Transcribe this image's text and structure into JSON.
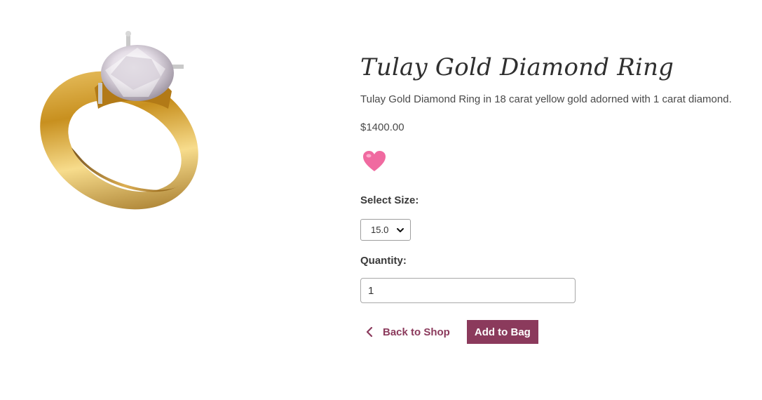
{
  "product": {
    "title": "Tulay Gold Diamond Ring",
    "description": "Tulay Gold Diamond Ring in 18 carat yellow gold adorned with 1 carat diamond.",
    "price": "$1400.00",
    "image_icon": "gold-diamond-ring-image"
  },
  "wishlist": {
    "icon": "heart-icon",
    "color": "#f06aa0"
  },
  "size": {
    "label": "Select Size:",
    "selected": "15.0"
  },
  "quantity": {
    "label": "Quantity:",
    "value": "1"
  },
  "actions": {
    "back_label": "Back to Shop",
    "add_label": "Add to Bag"
  },
  "colors": {
    "accent": "#8b3a5c",
    "text": "#4a4a4a"
  }
}
